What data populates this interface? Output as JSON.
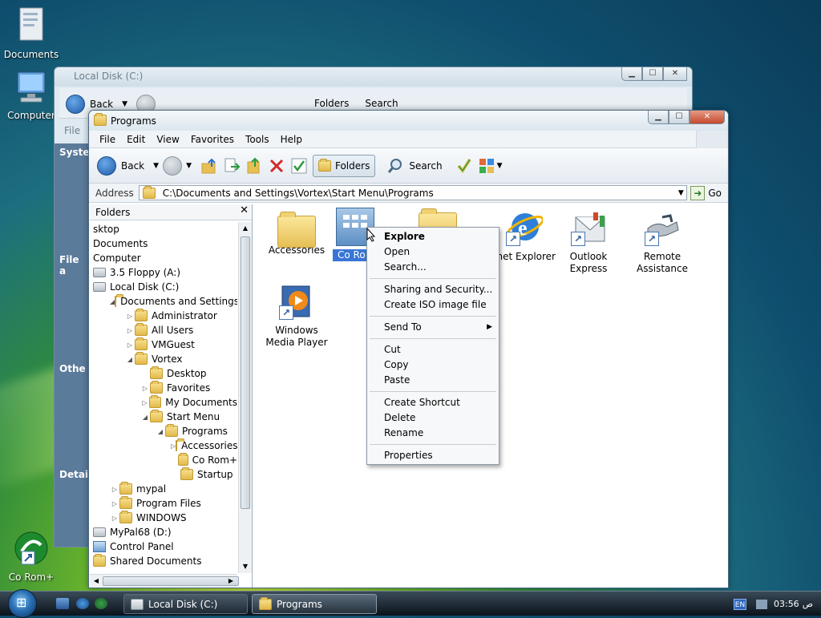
{
  "desktop": {
    "icons": [
      {
        "label": "Documents"
      },
      {
        "label": "Computer"
      },
      {
        "label": "Co Rom+"
      }
    ]
  },
  "back_window": {
    "title": "Local Disk (C:)",
    "toolbar": {
      "back": "Back",
      "folders": "Folders",
      "search": "Search"
    },
    "menu_first": "File",
    "left_labels": [
      "System",
      "File a",
      "Othe",
      "Detai"
    ]
  },
  "window": {
    "title": "Programs",
    "menu": [
      "File",
      "Edit",
      "View",
      "Favorites",
      "Tools",
      "Help"
    ],
    "toolbar": {
      "back": "Back",
      "folders": "Folders",
      "search": "Search"
    },
    "address": {
      "label": "Address",
      "value": "C:\\Documents and Settings\\Vortex\\Start Menu\\Programs",
      "go": "Go"
    },
    "folders_pane": {
      "title": "Folders",
      "tree": [
        {
          "label": "sktop",
          "depth": 0,
          "icon": "none",
          "exp": ""
        },
        {
          "label": "Documents",
          "depth": 0,
          "icon": "none",
          "exp": ""
        },
        {
          "label": "Computer",
          "depth": 0,
          "icon": "none",
          "exp": ""
        },
        {
          "label": "3.5 Floppy (A:)",
          "depth": 0,
          "icon": "drive",
          "exp": ""
        },
        {
          "label": "Local Disk (C:)",
          "depth": 0,
          "icon": "drive",
          "exp": ""
        },
        {
          "label": "Documents and Settings",
          "depth": 1,
          "icon": "folder",
          "exp": "open"
        },
        {
          "label": "Administrator",
          "depth": 2,
          "icon": "folder",
          "exp": "closed"
        },
        {
          "label": "All Users",
          "depth": 2,
          "icon": "folder",
          "exp": "closed"
        },
        {
          "label": "VMGuest",
          "depth": 2,
          "icon": "folder",
          "exp": "closed"
        },
        {
          "label": "Vortex",
          "depth": 2,
          "icon": "folder",
          "exp": "open"
        },
        {
          "label": "Desktop",
          "depth": 3,
          "icon": "folder",
          "exp": ""
        },
        {
          "label": "Favorites",
          "depth": 3,
          "icon": "folder",
          "exp": "closed"
        },
        {
          "label": "My Documents",
          "depth": 3,
          "icon": "folder",
          "exp": "closed"
        },
        {
          "label": "Start Menu",
          "depth": 3,
          "icon": "folder",
          "exp": "open"
        },
        {
          "label": "Programs",
          "depth": 4,
          "icon": "folder",
          "exp": "open"
        },
        {
          "label": "Accessories",
          "depth": 5,
          "icon": "folder",
          "exp": "closed"
        },
        {
          "label": "Co Rom+",
          "depth": 5,
          "icon": "folder",
          "exp": ""
        },
        {
          "label": "Startup",
          "depth": 5,
          "icon": "folder",
          "exp": ""
        },
        {
          "label": "mypal",
          "depth": 1,
          "icon": "folder",
          "exp": "closed"
        },
        {
          "label": "Program Files",
          "depth": 1,
          "icon": "folder",
          "exp": "closed"
        },
        {
          "label": "WINDOWS",
          "depth": 1,
          "icon": "folder",
          "exp": "closed"
        },
        {
          "label": "MyPal68 (D:)",
          "depth": 0,
          "icon": "drive",
          "exp": ""
        },
        {
          "label": "Control Panel",
          "depth": 0,
          "icon": "panel",
          "exp": ""
        },
        {
          "label": "Shared Documents",
          "depth": 0,
          "icon": "folder",
          "exp": ""
        }
      ]
    },
    "content_items": [
      {
        "label": "Accessories",
        "icon": "folder-icon"
      },
      {
        "label": "Co Ro",
        "icon": "co-rom-folder-icon",
        "selected": true
      },
      {
        "label": "",
        "icon": "folder-icon"
      },
      {
        "label": "net Explorer",
        "icon": "internet-explorer-icon"
      },
      {
        "label": "Outlook Express",
        "icon": "outlook-express-icon"
      },
      {
        "label": "Remote Assistance",
        "icon": "remote-assistance-icon"
      },
      {
        "label": "Windows Media Player",
        "icon": "windows-media-player-icon"
      }
    ],
    "context_menu": [
      {
        "label": "Explore",
        "bold": true
      },
      {
        "label": "Open"
      },
      {
        "label": "Search..."
      },
      {
        "sep": true
      },
      {
        "label": "Sharing and Security..."
      },
      {
        "label": "Create ISO image file"
      },
      {
        "sep": true
      },
      {
        "label": "Send To",
        "submenu": true
      },
      {
        "sep": true
      },
      {
        "label": "Cut"
      },
      {
        "label": "Copy"
      },
      {
        "label": "Paste"
      },
      {
        "sep": true
      },
      {
        "label": "Create Shortcut"
      },
      {
        "label": "Delete"
      },
      {
        "label": "Rename"
      },
      {
        "sep": true
      },
      {
        "label": "Properties"
      }
    ]
  },
  "taskbar": {
    "tasks": [
      {
        "label": "Local Disk (C:)"
      },
      {
        "label": "Programs"
      }
    ],
    "tray": {
      "lang": "EN",
      "time": "03:56",
      "ampm": "ص"
    }
  }
}
